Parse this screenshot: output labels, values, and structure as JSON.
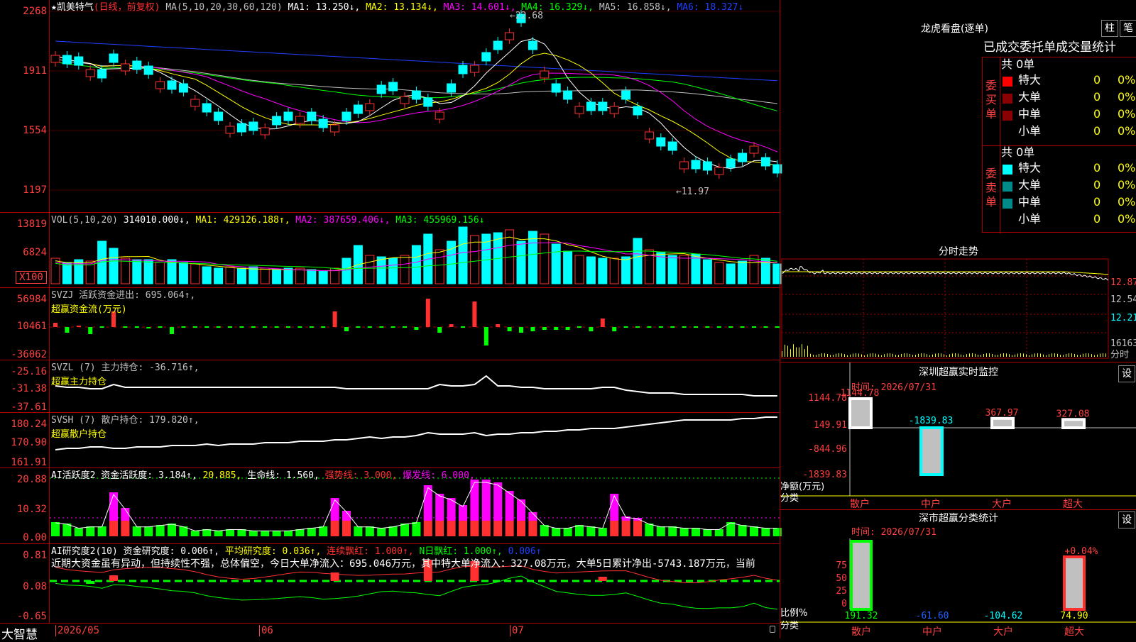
{
  "colors": {
    "up": "#ff3030",
    "down": "#00ffff",
    "ma1": "#ffffff",
    "ma2": "#ffff00",
    "ma3": "#ff00ff",
    "ma4": "#00ff00",
    "ma5": "#c0c0c0",
    "ma6": "#2040ff"
  },
  "main": {
    "title": "★凯美特气",
    "mode": "(日线，前复权)",
    "ma_params": "MA(5,10,20,30,60,120)",
    "ma1": "MA1: 13.250↓,",
    "ma2": "MA2: 13.134↓,",
    "ma3": "MA3: 14.601↓,",
    "ma4": "MA4: 16.329↓,",
    "ma5": "MA5: 16.858↓,",
    "ma6": "MA6: 18.327↓",
    "yticks": [
      "2268",
      "1911",
      "1554",
      "1197"
    ],
    "high_label": "←22.68",
    "low_label": "←11.97"
  },
  "vol": {
    "label": "VOL(5,10,20)",
    "value": "314010.000↓,",
    "ma1": "MA1: 429126.188↑,",
    "ma2": "MA2: 387659.406↓,",
    "ma3": "MA3: 455969.156↓",
    "yticks": [
      "13819",
      "6824"
    ],
    "unit": "X100"
  },
  "svzj": {
    "label": "SVZJ  活跃资金进出: 695.064↑,",
    "sub": "超赢资金流(万元)",
    "yticks": [
      "56984",
      "10461",
      "-36062"
    ]
  },
  "svzl": {
    "label": "SVZL (7) 主力持仓: -36.716↑,",
    "sub": "超赢主力持仓",
    "yticks": [
      "-25.16",
      "-31.38",
      "-37.61"
    ]
  },
  "svsh": {
    "label": "SVSH (7) 散户持仓: 179.820↑,",
    "sub": "超赢散户持仓",
    "yticks": [
      "180.24",
      "170.90",
      "161.91"
    ]
  },
  "ai1": {
    "label": "AI活跃度2 资金活跃度: 3.184↑,",
    "v2": "20.885,",
    "life": "生命线: 1.560,",
    "strong": "强势线: 3.000,",
    "burst": "爆发线: 6.000,",
    "yticks": [
      "20.88",
      "10.32",
      "0.00"
    ]
  },
  "ai2": {
    "label": "AI研究度2(10) 资金研究度: 0.006↑,",
    "avg": "平均研究度: 0.036↑,",
    "cont": "连续飘红: 1.000↑,",
    "nday": "N日飘红: 1.000↑,",
    "last": "0.006↑",
    "text": "近期大资金虽有异动，但持续性不强，总体偏空，今日大单净流入：695.046万元，其中特大单净流入：327.08万元，大单5日累计净出-5743.187万元，当前",
    "yticks": [
      "0.81",
      "0.08",
      "-0.65"
    ]
  },
  "xaxis": {
    "brand": "大智慧",
    "labels": [
      "2026/05",
      "06",
      "07"
    ]
  },
  "lhb": {
    "title": "龙虎看盘(逐单)",
    "btn1": "柱",
    "btn2": "笔",
    "header": "已成交委托单成交量统计",
    "buy_total": "共 0单",
    "sell_total": "共 0单",
    "buy_label": "委买单",
    "sell_label": "委卖单",
    "rows": [
      {
        "name": "特大",
        "v": "0",
        "p": "0%"
      },
      {
        "name": "大单",
        "v": "0",
        "p": "0%"
      },
      {
        "name": "中单",
        "v": "0",
        "p": "0%"
      },
      {
        "name": "小单",
        "v": "0",
        "p": "0%"
      }
    ]
  },
  "fenshi": {
    "title": "分时走势",
    "prices": [
      "12.87",
      "12.54",
      "12.21"
    ],
    "vol": "16163",
    "label": "分时"
  },
  "sz_monitor": {
    "title": "深圳超赢实时监控",
    "btn": "设",
    "time": "时间: 2026/07/31",
    "yticks": [
      "1144.78",
      "149.91",
      "-844.96",
      "-1839.83"
    ],
    "ylabel": "净额(万元)",
    "xlabel": "分类",
    "bars": [
      {
        "name": "散户",
        "val": "1144.78",
        "v": 1144.78
      },
      {
        "name": "中户",
        "val": "-1839.83",
        "v": -1839.83
      },
      {
        "name": "大户",
        "val": "367.97",
        "v": 367.97
      },
      {
        "name": "超大",
        "val": "327.08",
        "v": 327.08
      }
    ]
  },
  "sz_class": {
    "title": "深市超赢分类统计",
    "btn": "设",
    "time": "时间: 2026/07/31",
    "yticks": [
      "75",
      "50",
      "25",
      "0"
    ],
    "ylabel": "比例%",
    "xlabel": "分类",
    "pct": "+0.04%",
    "bars": [
      {
        "name": "散户",
        "val": "191.32"
      },
      {
        "name": "中户",
        "val": "-61.60"
      },
      {
        "name": "大户",
        "val": "-104.62"
      },
      {
        "name": "超大",
        "val": "74.90"
      }
    ]
  }
}
